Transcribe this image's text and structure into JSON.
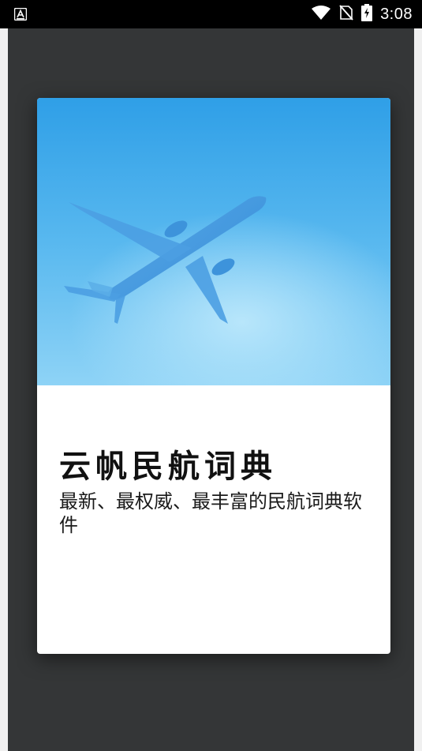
{
  "status_bar": {
    "time": "3:08",
    "icons": [
      "notification-a-icon",
      "wifi-icon",
      "no-sim-icon",
      "battery-charging-icon"
    ]
  },
  "card": {
    "title": "云帆民航词典",
    "subtitle": "最新、最权威、最丰富的民航词典软件",
    "hero_image": "airplane-icon"
  },
  "colors": {
    "status_bar_bg": "#000000",
    "backdrop": "#343637",
    "hero_top": "#2f9fe7",
    "hero_bottom": "#8ed3f6",
    "card_bg": "#ffffff",
    "title_text": "#111111"
  }
}
